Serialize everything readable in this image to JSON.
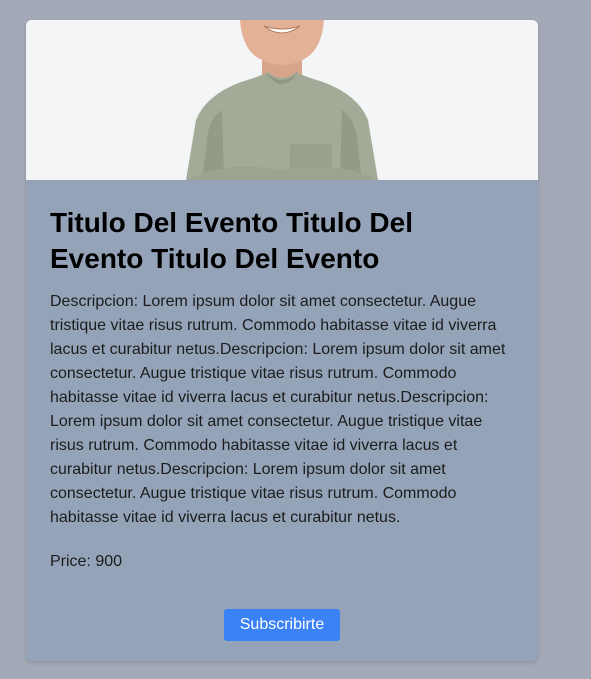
{
  "event": {
    "title": "Titulo Del Evento Titulo Del Evento Titulo Del Evento",
    "description": "Descripcion: Lorem ipsum dolor sit amet consectetur. Augue tristique vitae risus rutrum. Commodo habitasse vitae id viverra lacus et curabitur netus.Descripcion: Lorem ipsum dolor sit amet consectetur. Augue tristique vitae risus rutrum. Commodo habitasse vitae id viverra lacus et curabitur netus.Descripcion: Lorem ipsum dolor sit amet consectetur. Augue tristique vitae risus rutrum. Commodo habitasse vitae id viverra lacus et curabitur netus.Descripcion: Lorem ipsum dolor sit amet consectetur. Augue tristique vitae risus rutrum. Commodo habitasse vitae id viverra lacus et curabitur netus.",
    "price": "Price: 900",
    "subscribe_label": "Subscribirte"
  },
  "colors": {
    "page_background": "#a3a9b6",
    "card_background": "#94a3b8",
    "button_background": "#3b82f6"
  }
}
